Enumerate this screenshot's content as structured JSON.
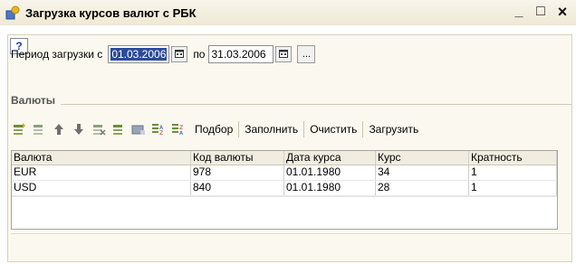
{
  "window": {
    "title": "Загрузка курсов валют с РБК",
    "controls": {
      "minimize": "_",
      "maximize": "□",
      "close": "×"
    }
  },
  "help": {
    "label": "?"
  },
  "period": {
    "label_from": "Период загрузки с",
    "from_value": "01.03.2006",
    "label_to": "по",
    "to_value": "31.03.2006",
    "more_button": "..."
  },
  "currencies": {
    "title": "Валюты",
    "toolbar": {
      "pick": "Подбор",
      "fill": "Заполнить",
      "clear": "Очистить",
      "load": "Загрузить"
    },
    "columns": [
      "Валюта",
      "Код валюты",
      "Дата курса",
      "Курс",
      "Кратность"
    ],
    "rows": [
      [
        "EUR",
        "978",
        "01.01.1980",
        "34",
        "1"
      ],
      [
        "USD",
        "840",
        "01.01.1980",
        "28",
        "1"
      ]
    ]
  }
}
